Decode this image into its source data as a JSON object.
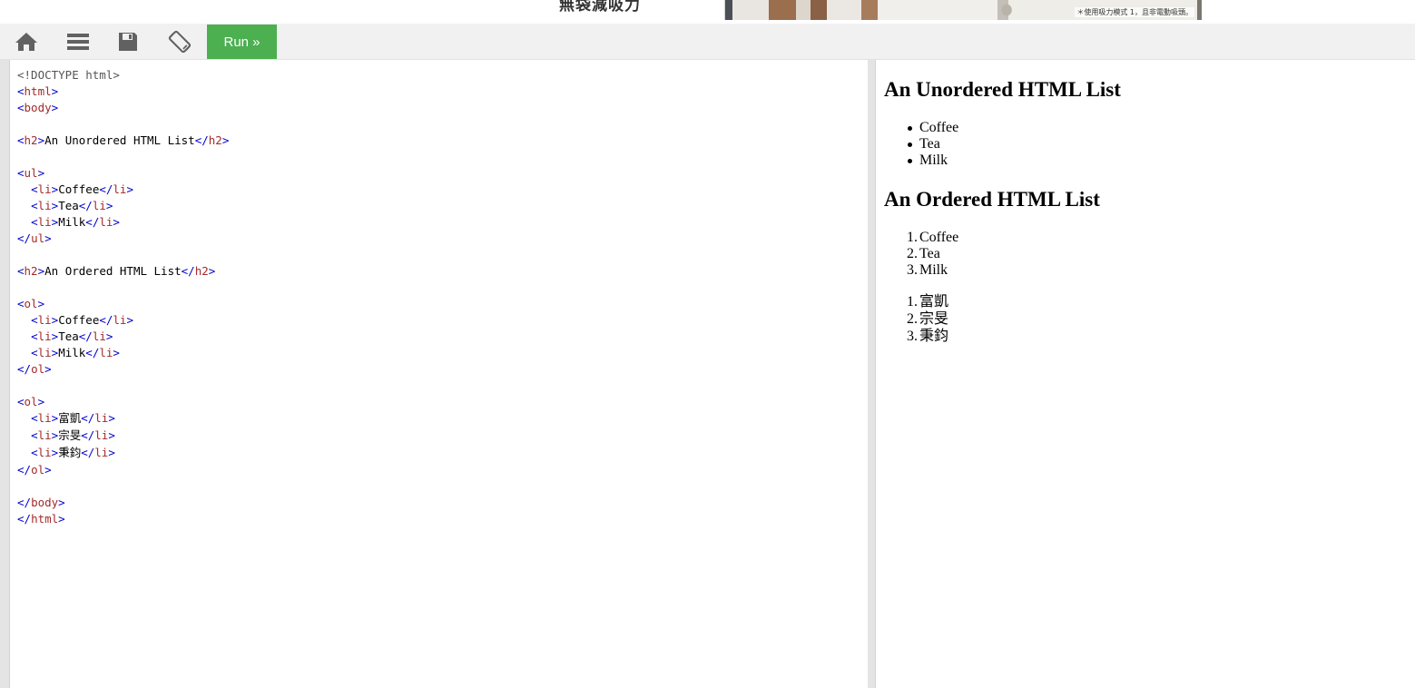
{
  "ad": {
    "headline": "無袋減吸力",
    "caption": "＊使用吸力模式 1，且非電動吸頭。"
  },
  "toolbar": {
    "home_icon": "home-icon",
    "menu_icon": "menu-icon",
    "save_icon": "save-icon",
    "rotate_icon": "rotate-icon",
    "run_label": "Run »"
  },
  "editor": {
    "lines": [
      "<!DOCTYPE html>",
      "<html>",
      "<body>",
      "",
      "<h2>An Unordered HTML List</h2>",
      "",
      "<ul>",
      "  <li>Coffee</li>",
      "  <li>Tea</li>",
      "  <li>Milk</li>",
      "</ul>",
      "",
      "<h2>An Ordered HTML List</h2>",
      "",
      "<ol>",
      "  <li>Coffee</li>",
      "  <li>Tea</li>",
      "  <li>Milk</li>",
      "</ol>",
      "",
      "<ol>",
      "  <li>富凱</li>",
      "  <li>宗旻</li>",
      "  <li>秉鈞</li>",
      "</ol>",
      "",
      "</body>",
      "</html>"
    ]
  },
  "result": {
    "unordered_heading": "An Unordered HTML List",
    "unordered_items": [
      "Coffee",
      "Tea",
      "Milk"
    ],
    "ordered_heading": "An Ordered HTML List",
    "ordered_items": [
      "Coffee",
      "Tea",
      "Milk"
    ],
    "ordered_numbers": [
      "1.",
      "2.",
      "3."
    ],
    "second_ordered_items": [
      "富凱",
      "宗旻",
      "秉鈞"
    ],
    "second_ordered_numbers": [
      "1.",
      "2.",
      "3."
    ]
  },
  "colors": {
    "run_button": "#4caf50",
    "toolbar_bg": "#f1f1f1",
    "tag_bracket": "#0000cd",
    "tag_name": "#a52a2a",
    "icon": "#616161"
  }
}
